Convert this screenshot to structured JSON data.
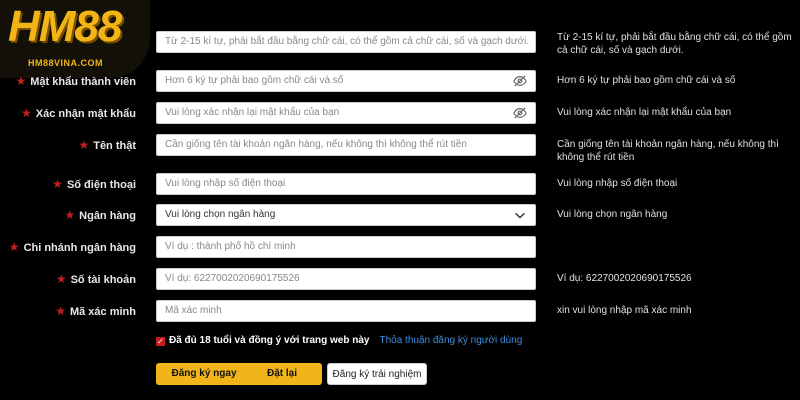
{
  "brand": {
    "logo_text": "HM88",
    "logo_sub": "HM88VINA.COM",
    "color": "#f3b515"
  },
  "form": {
    "username": {
      "placeholder": "Từ 2-15 kí tự, phải bắt đầu bằng chữ cái, có thể  gồm cả chữ cái, số và gạch dưới.",
      "hint": "Từ 2-15 kí tự, phải bắt đầu bằng chữ cái, có thể gồm cả chữ cái, số và gạch dưới."
    },
    "password": {
      "label": "Mật khẩu thành viên",
      "placeholder": "Hơn 6 ký tự phải bao gồm chữ cái và số",
      "hint": "Hơn 6 ký tự phải bao gồm chữ cái và số"
    },
    "confirm_password": {
      "label": "Xác nhận mật khẩu",
      "placeholder": "Vui lòng xác nhận lại mật khẩu của bạn",
      "hint": "Vui lòng xác nhận lại mật khẩu của bạn"
    },
    "real_name": {
      "label": "Tên thật",
      "placeholder": "Cần giống tên tài khoản ngân hàng, nếu không thì không thể rút tiền",
      "hint": "Cần giống tên tài khoản ngân hàng, nếu không thì không thể rút tiền"
    },
    "phone": {
      "label": "Số điện thoại",
      "placeholder": "Vui lòng nhập số điện thoại",
      "hint": "Vui lòng nhập số điện thoại"
    },
    "bank": {
      "label": "Ngân hàng",
      "value": "Vui lòng chọn ngân hàng",
      "hint": "Vui lòng chọn ngân hàng"
    },
    "branch": {
      "label": "Chi nhánh ngân hàng",
      "placeholder": "Ví dụ : thành phố hồ chí minh"
    },
    "account_number": {
      "label": "Số tài khoản",
      "placeholder": "Ví dụ:  6227002020690175526",
      "hint": "Ví dụ:   6227002020690175526"
    },
    "captcha": {
      "label": "Mã xác minh",
      "placeholder": "Mã xác minh",
      "hint": "xin vui lòng nhập mã xác minh"
    },
    "agree": {
      "text": "Đã đủ 18 tuổi và đồng ý với trang web này",
      "link": "Thỏa thuận đăng ký người dùng",
      "checked": true
    }
  },
  "buttons": {
    "register": "Đăng ký ngay",
    "reset": "Đặt lại",
    "trial": "Đăng ký trải nghiệm"
  },
  "colors": {
    "gold": "#f2b41b",
    "required_star": "#c41e1e",
    "link": "#3d8ee0"
  }
}
